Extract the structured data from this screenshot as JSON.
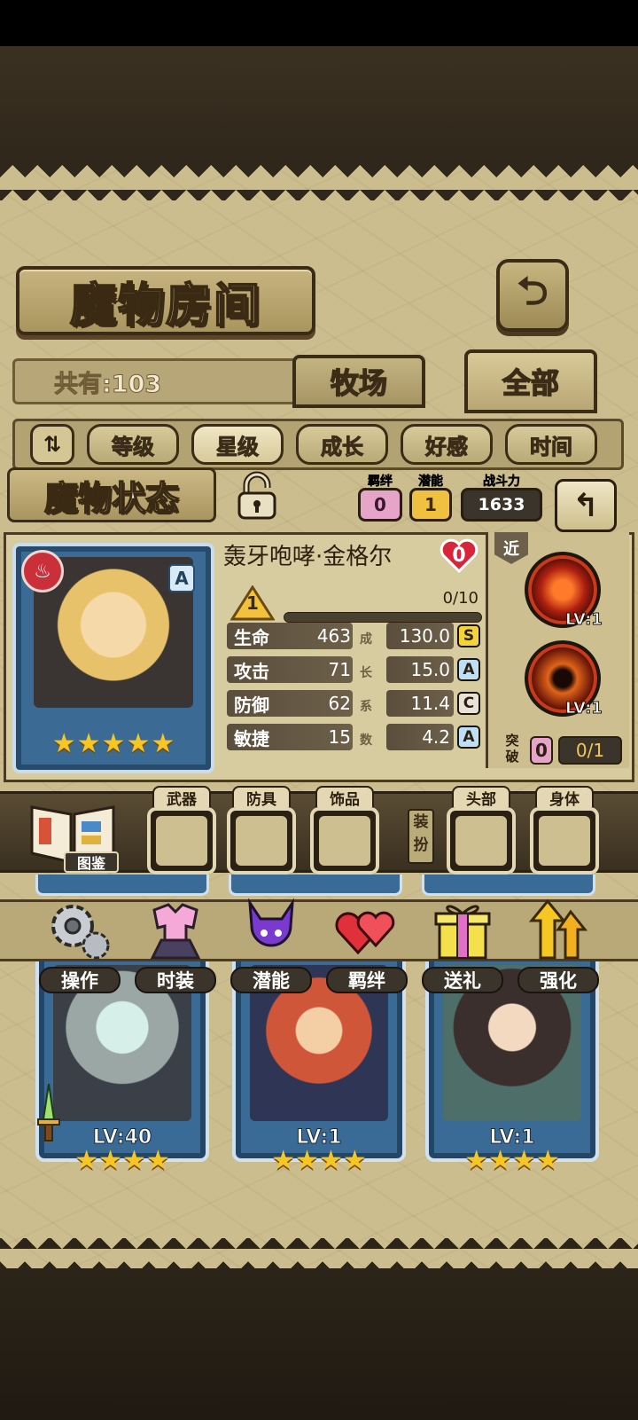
{
  "header": {
    "title": "魔物房间",
    "count_text": "共有:103",
    "tabs": [
      {
        "label": "牧场"
      },
      {
        "label": "全部"
      }
    ]
  },
  "sort": {
    "icon": "sort-order-icon",
    "options": [
      {
        "label": "等级",
        "active": false
      },
      {
        "label": "星级",
        "active": true
      },
      {
        "label": "成长",
        "active": false
      },
      {
        "label": "好感",
        "active": false
      },
      {
        "label": "时间",
        "active": false
      }
    ]
  },
  "status": {
    "title": "魔物状态",
    "bond_label": "羁绊",
    "bond_value": "0",
    "potential_label": "潜能",
    "potential_value": "1",
    "power_label": "战斗力",
    "power_value": "1633",
    "monster": {
      "name": "轰牙咆哮·金格尔",
      "affection": "0",
      "level": "1",
      "exp_text": "0/10",
      "exp_fraction": 0,
      "rank": "A",
      "stars": 5,
      "element_icon": "fire-icon"
    },
    "stats": [
      {
        "name": "生命",
        "value": "463",
        "growth": "130.0",
        "grade": "S",
        "grade_color": "#f3d23a"
      },
      {
        "name": "攻击",
        "value": "71",
        "growth": "15.0",
        "grade": "A",
        "grade_color": "#bfe0f4"
      },
      {
        "name": "防御",
        "value": "62",
        "growth": "11.4",
        "grade": "C",
        "grade_color": "#e8e3d6"
      },
      {
        "name": "敏捷",
        "value": "15",
        "growth": "4.2",
        "grade": "A",
        "grade_color": "#bfe0f4"
      }
    ],
    "growth_coefficient_chars": [
      "成",
      "长",
      "系",
      "数"
    ],
    "range_tag": "近",
    "skills": [
      {
        "icon": "tiger-skill-icon",
        "level": "LV:1"
      },
      {
        "icon": "vortex-skill-icon",
        "level": "LV:1"
      }
    ],
    "breakthrough": {
      "label": "突破",
      "count": "0",
      "progress": "0/1"
    }
  },
  "equipment": {
    "codex_label": "图鉴",
    "dress_label": "装扮",
    "slots": [
      {
        "label": "武器"
      },
      {
        "label": "防具"
      },
      {
        "label": "饰品"
      },
      {
        "label": "头部"
      },
      {
        "label": "身体"
      }
    ]
  },
  "actions": [
    {
      "label": "操作",
      "icon": "gear-icon"
    },
    {
      "label": "时装",
      "icon": "outfit-icon"
    },
    {
      "label": "潜能",
      "icon": "demon-icon"
    },
    {
      "label": "羁绊",
      "icon": "hearts-icon"
    },
    {
      "label": "送礼",
      "icon": "gift-icon"
    },
    {
      "label": "强化",
      "icon": "upgrade-arrows-icon"
    }
  ],
  "cards": [
    {
      "level": "LV:40",
      "stars": "★★★★",
      "weapon": true
    },
    {
      "level": "LV:1",
      "stars": "★★★★"
    },
    {
      "level": "LV:1",
      "stars": "★★★★"
    }
  ],
  "colors": {
    "board": "#cbbd8e",
    "card_blue": "#3a6a96",
    "star_gold": "#f6c623",
    "bond_pink": "#e7a4c9",
    "potential_yellow": "#f0c040"
  }
}
